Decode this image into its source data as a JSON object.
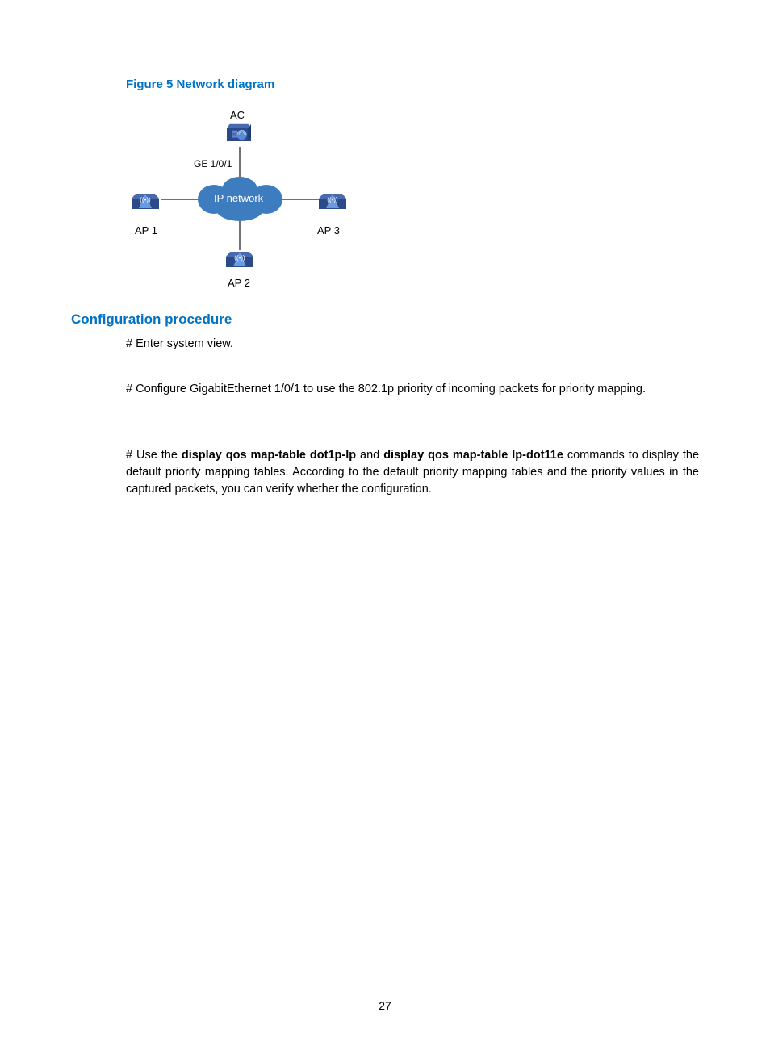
{
  "figure": {
    "title": "Figure 5 Network diagram",
    "labels": {
      "ac": "AC",
      "ge": "GE 1/0/1",
      "cloud": "IP network",
      "ap1": "AP 1",
      "ap2": "AP 2",
      "ap3": "AP 3"
    }
  },
  "section": {
    "heading": "Configuration procedure",
    "p1": "# Enter system view.",
    "p2": "# Configure GigabitEthernet 1/0/1 to use the 802.1p priority of incoming packets for priority mapping.",
    "p3_pre": "# Use the ",
    "p3_b1": "display qos map-table dot1p-lp",
    "p3_mid": " and ",
    "p3_b2": "display qos map-table lp-dot11e",
    "p3_post": " commands to display the default priority mapping tables. According to the default priority mapping tables and the priority values in the captured packets, you can verify whether the configuration."
  },
  "pageNumber": "27"
}
